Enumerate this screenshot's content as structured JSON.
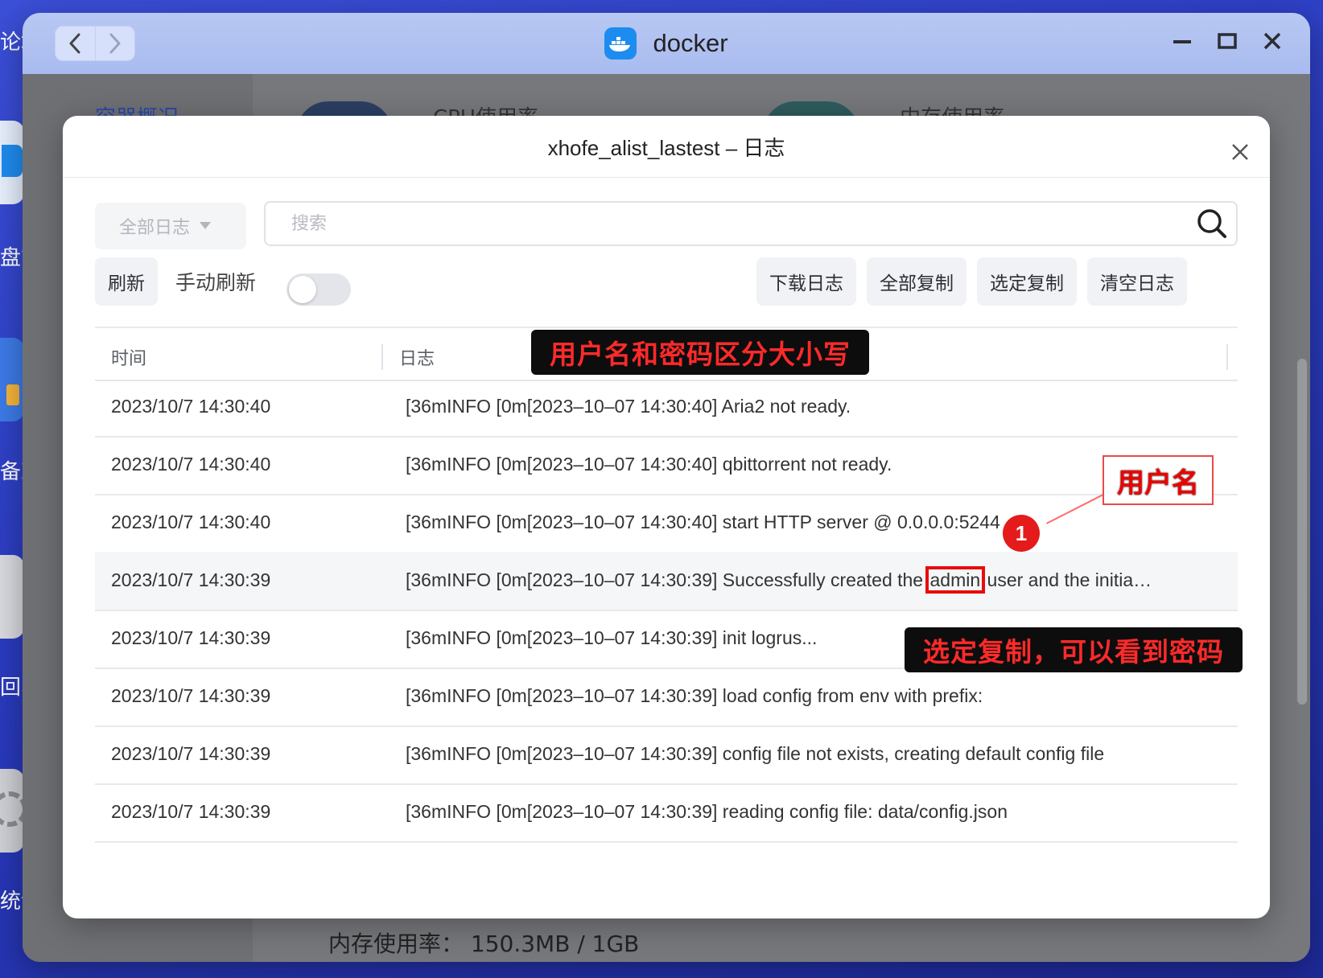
{
  "desktop": {
    "labels": [
      "论坛",
      "盘管",
      "备忘",
      "回收",
      "统计"
    ]
  },
  "window": {
    "title": "docker",
    "back_label": "<",
    "forward_label": ">"
  },
  "background": {
    "tab_overview": "容器概况",
    "cpu_label": "CPU使用率",
    "mem_label": "内存使用率",
    "mem_detail": "内存使用率： 150.3MB / 1GB"
  },
  "modal": {
    "title": "xhofe_alist_lastest – 日志",
    "filter_value": "全部日志",
    "search_placeholder": "搜索",
    "refresh_label": "刷新",
    "manual_refresh_label": "手动刷新",
    "manual_refresh_on": false,
    "buttons": {
      "download": "下载日志",
      "copy_all": "全部复制",
      "copy_selected": "选定复制",
      "clear": "清空日志"
    },
    "columns": {
      "time": "时间",
      "log": "日志"
    },
    "rows": [
      {
        "time": "2023/10/7 14:30:40",
        "log": "[36mINFO [0m[2023–10–07 14:30:40] Aria2 not ready."
      },
      {
        "time": "2023/10/7 14:30:40",
        "log": "[36mINFO [0m[2023–10–07 14:30:40] qbittorrent not ready."
      },
      {
        "time": "2023/10/7 14:30:40",
        "log": "[36mINFO [0m[2023–10–07 14:30:40] start HTTP server @ 0.0.0.0:5244"
      },
      {
        "time": "2023/10/7 14:30:39",
        "log_prefix": "[36mINFO [0m[2023–10–07 14:30:39] Successfully created the ",
        "log_highlight": "admin",
        "log_suffix": " user and the initia…"
      },
      {
        "time": "2023/10/7 14:30:39",
        "log": "[36mINFO [0m[2023–10–07 14:30:39] init logrus..."
      },
      {
        "time": "2023/10/7 14:30:39",
        "log": "[36mINFO [0m[2023–10–07 14:30:39] load config from env with prefix:"
      },
      {
        "time": "2023/10/7 14:30:39",
        "log": "[36mINFO [0m[2023–10–07 14:30:39] config file not exists, creating default config file"
      },
      {
        "time": "2023/10/7 14:30:39",
        "log": "[36mINFO [0m[2023–10–07 14:30:39] reading config file: data/config.json"
      }
    ]
  },
  "annotations": {
    "case_sensitive": "用户名和密码区分大小写",
    "username": "用户名",
    "step_number": "1",
    "copy_hint": "选定复制，可以看到密码"
  },
  "colors": {
    "accent_red": "#e51a1a",
    "titlebar": "#b8c8f3",
    "docker_blue": "#1d8cf0"
  }
}
